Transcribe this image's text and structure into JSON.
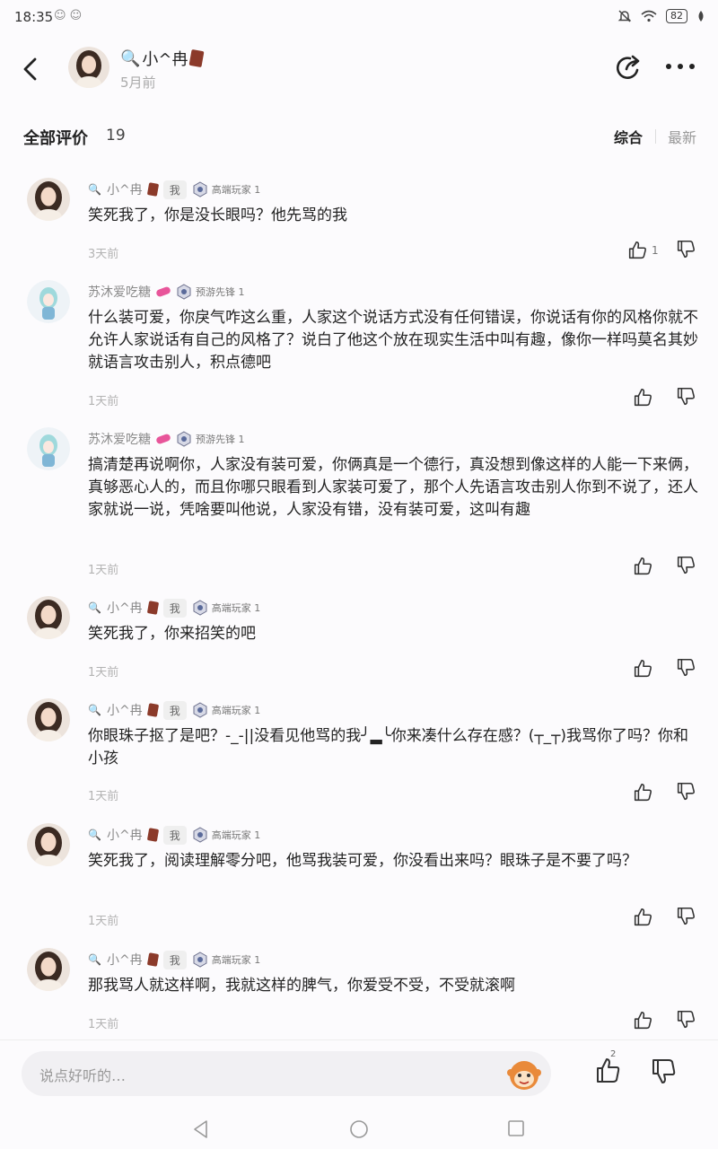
{
  "status_bar": {
    "time": "18:35",
    "battery": "82"
  },
  "header": {
    "name": "小^冉",
    "time": "5月前"
  },
  "filter": {
    "title": "全部评价",
    "count": "19",
    "tab_overall": "综合",
    "tab_latest": "最新"
  },
  "comments": [
    {
      "user": "小^冉",
      "is_me": true,
      "me_label": "我",
      "rank": "高端玩家 1",
      "text": "笑死我了，你是没长眼吗？他先骂的我",
      "time": "3天前",
      "likes": "1"
    },
    {
      "user": "苏沐爱吃糖",
      "is_me": false,
      "me_label": "",
      "rank": "预游先锋 1",
      "text": "什么装可爱，你戾气咋这么重，人家这个说话方式没有任何错误，你说话有你的风格你就不允许人家说话有自己的风格了？说白了他这个放在现实生活中叫有趣，像你一样吗莫名其妙就语言攻击别人，积点德吧",
      "time": "1天前",
      "likes": ""
    },
    {
      "user": "苏沐爱吃糖",
      "is_me": false,
      "me_label": "",
      "rank": "预游先锋 1",
      "text": "搞清楚再说啊你，人家没有装可爱，你俩真是一个德行，真没想到像这样的人能一下来俩，真够恶心人的，而且你哪只眼看到人家装可爱了，那个人先语言攻击别人你到不说了，还人家就说一说，凭啥要叫他说，人家没有错，没有装可爱，这叫有趣",
      "time": "1天前",
      "likes": ""
    },
    {
      "user": "小^冉",
      "is_me": true,
      "me_label": "我",
      "rank": "高端玩家 1",
      "text": "笑死我了，你来招笑的吧",
      "time": "1天前",
      "likes": ""
    },
    {
      "user": "小^冉",
      "is_me": true,
      "me_label": "我",
      "rank": "高端玩家 1",
      "text": "你眼珠子抠了是吧？-_-||没看见他骂的我╯▂╰你来凑什么存在感？(┬_┬)我骂你了吗？你和小孩",
      "time": "1天前",
      "likes": ""
    },
    {
      "user": "小^冉",
      "is_me": true,
      "me_label": "我",
      "rank": "高端玩家 1",
      "text": "笑死我了，阅读理解零分吧，他骂我装可爱，你没看出来吗？眼珠子是不要了吗？",
      "time": "1天前",
      "likes": ""
    },
    {
      "user": "小^冉",
      "is_me": true,
      "me_label": "我",
      "rank": "高端玩家 1",
      "text": "那我骂人就这样啊，我就这样的脾气，你爱受不受，不受就滚啊",
      "time": "1天前",
      "likes": ""
    }
  ],
  "input": {
    "placeholder": "说点好听的…",
    "like_count": "2"
  },
  "colors": {
    "brand_pink": "#e8559a",
    "avatar_bg": "#e9d7c8"
  }
}
